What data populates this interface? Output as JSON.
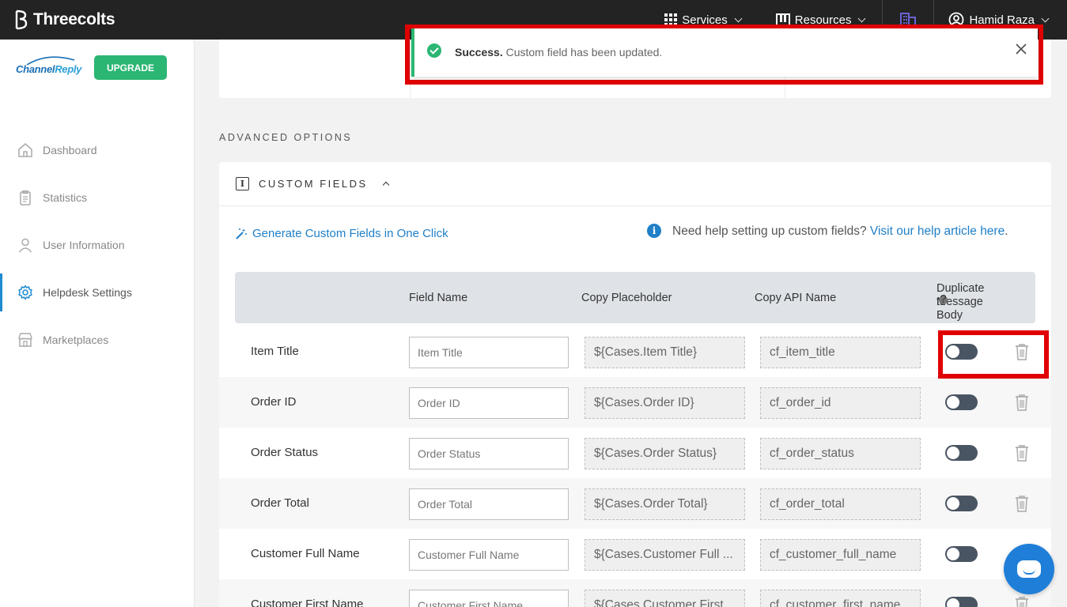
{
  "topbar": {
    "brand": "Threecolts",
    "services": "Services",
    "resources": "Resources",
    "user": "Hamid Raza"
  },
  "sidebar": {
    "logo_a": "Channel",
    "logo_b": "Reply",
    "upgrade": "UPGRADE",
    "items": [
      {
        "label": "Dashboard",
        "icon": "home-icon"
      },
      {
        "label": "Statistics",
        "icon": "clipboard-icon"
      },
      {
        "label": "User Information",
        "icon": "user-icon"
      },
      {
        "label": "Helpdesk Settings",
        "icon": "gear-icon",
        "active": true
      },
      {
        "label": "Marketplaces",
        "icon": "store-icon"
      }
    ]
  },
  "toast": {
    "title": "Success.",
    "message": "Custom field has been updated."
  },
  "advanced": {
    "section_title": "ADVANCED OPTIONS",
    "card_title": "CUSTOM FIELDS",
    "generate_link": "Generate Custom Fields in One Click",
    "help_text": "Need help setting up custom fields?",
    "help_link": "Visit our help article",
    "help_link_2": "here",
    "help_tail": "."
  },
  "table": {
    "headers": {
      "field_name": "Field Name",
      "copy_placeholder": "Copy Placeholder",
      "copy_api": "Copy API Name",
      "duplicate_1": "Duplicate to",
      "duplicate_2": "Message Body"
    },
    "rows": [
      {
        "label": "Item Title",
        "field": "Item Title",
        "placeholder": "${Cases.Item Title}",
        "api": "cf_item_title"
      },
      {
        "label": "Order ID",
        "field": "Order ID",
        "placeholder": "${Cases.Order ID}",
        "api": "cf_order_id"
      },
      {
        "label": "Order Status",
        "field": "Order Status",
        "placeholder": "${Cases.Order Status}",
        "api": "cf_order_status"
      },
      {
        "label": "Order Total",
        "field": "Order Total",
        "placeholder": "${Cases.Order Total}",
        "api": "cf_order_total"
      },
      {
        "label": "Customer Full Name",
        "field": "Customer Full Name",
        "placeholder": "${Cases.Customer Full ...",
        "api": "cf_customer_full_name"
      },
      {
        "label": "Customer First Name",
        "field": "Customer First Name",
        "placeholder": "${Cases.Customer First ...",
        "api": "cf_customer_first_name"
      }
    ]
  },
  "colors": {
    "accent": "#1f7fc7",
    "success": "#2bb673",
    "highlight": "#e00000",
    "topbar": "#232323"
  }
}
